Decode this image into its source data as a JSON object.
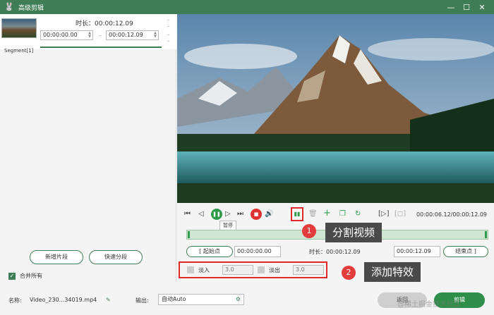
{
  "window": {
    "title": "高级剪辑",
    "app_icon": "🐰",
    "controls": [
      "—",
      "☐",
      "✕"
    ]
  },
  "segment": {
    "duration_label": "时长：00:00:12.09",
    "start_time": "00:00:00.00",
    "end_time": "00:00:12.09",
    "label": "Segment[1]",
    "dash": "–"
  },
  "left_buttons": {
    "add_segment": "新增片段",
    "quick_split": "快速分段"
  },
  "merge_all": "合并所有",
  "player": {
    "pause_tooltip": "暂停",
    "current_time": "00:00:06.12/00:00:12.09"
  },
  "range": {
    "start_btn": "起始点",
    "start_value": "00:00:00.00",
    "duration_label": "时长：00:00:12.09",
    "end_value": "00:00:12.09",
    "end_btn": "结束点"
  },
  "effects": {
    "fade_in": "淡入",
    "fade_in_value": "3.0",
    "fade_out": "淡出",
    "fade_out_value": "3.0"
  },
  "callouts": {
    "one_num": "1",
    "one_text": "分割视频",
    "two_num": "2",
    "two_text": "添加特效"
  },
  "bottom": {
    "name_label": "名称:",
    "name_value": "Video_230...34019.mp4",
    "output_label": "输出:",
    "output_value": "自动Auto",
    "back": "返回",
    "edit": "剪辑"
  },
  "watermark": "@稀土掘金技术社区",
  "colors": {
    "accent": "#3f7d56",
    "highlight": "#e02828",
    "play": "#2f9a4c",
    "stop": "#e0332f"
  }
}
